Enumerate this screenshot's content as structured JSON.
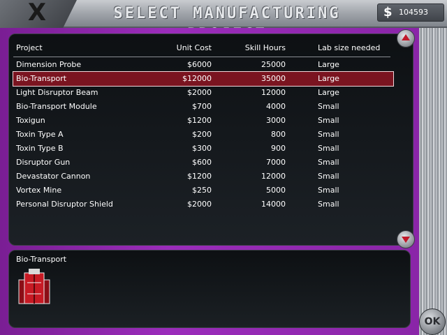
{
  "title": "SELECT MANUFACTURING PROJECT",
  "funds": {
    "icon": "dollar-icon",
    "value": "104593"
  },
  "table": {
    "headers": [
      "Project",
      "Unit Cost",
      "Skill Hours",
      "Lab size needed"
    ],
    "rows": [
      [
        "Dimension Probe",
        "$6000",
        "25000",
        "Large"
      ],
      [
        "Bio-Transport",
        "$12000",
        "35000",
        "Large"
      ],
      [
        "Light Disruptor Beam",
        "$2000",
        "12000",
        "Large"
      ],
      [
        "Bio-Transport Module",
        "$700",
        "4000",
        "Small"
      ],
      [
        "Toxigun",
        "$1200",
        "3000",
        "Small"
      ],
      [
        "Toxin Type A",
        "$200",
        "800",
        "Small"
      ],
      [
        "Toxin Type B",
        "$300",
        "900",
        "Small"
      ],
      [
        "Disruptor Gun",
        "$600",
        "7000",
        "Small"
      ],
      [
        "Devastator Cannon",
        "$1200",
        "12000",
        "Small"
      ],
      [
        "Vortex Mine",
        "$250",
        "5000",
        "Small"
      ],
      [
        "Personal Disruptor Shield",
        "$2000",
        "14000",
        "Small"
      ]
    ],
    "selected_index": 1
  },
  "detail": {
    "name": "Bio-Transport",
    "image_icon": "bio-transport-icon"
  },
  "ok_label": "OK",
  "colors": {
    "frame": "#9b2cbb",
    "selection": "#7a1420",
    "arrow": "#c0192a"
  }
}
